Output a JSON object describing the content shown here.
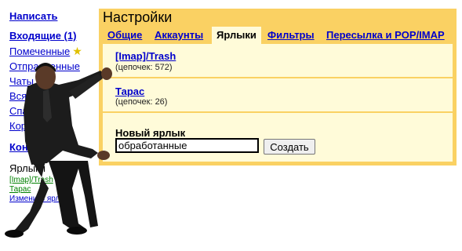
{
  "nav": {
    "compose": "Написать",
    "inbox": "Входящие (1)",
    "starred": "Помеченные",
    "sent": "Отправленные",
    "chats": "Чаты",
    "all_mail": "Вся почта",
    "spam": "Спам",
    "trash": "Корзина",
    "contacts": "Контакты",
    "labels_heading": "Ярлыки",
    "label_imap_trash": "[Imap]/Trash",
    "label_taras": "Тарас",
    "edit_labels": "Изменить ярлыки"
  },
  "settings": {
    "title": "Настройки",
    "tabs": [
      {
        "label": "Общие",
        "active": false
      },
      {
        "label": "Аккаунты",
        "active": false
      },
      {
        "label": "Ярлыки",
        "active": true
      },
      {
        "label": "Фильтры",
        "active": false
      },
      {
        "label": "Пересылка и POP/IMAP",
        "active": false
      }
    ],
    "labels": [
      {
        "name": "[Imap]/Trash",
        "count": "(цепочек: 572)"
      },
      {
        "name": "Тарас",
        "count": "(цепочек: 26)"
      }
    ],
    "new_label_heading": "Новый ярлык",
    "new_label_value": "обработанные",
    "create_button": "Создать"
  },
  "colors": {
    "panel": "#fad163",
    "content": "#fffbd9",
    "link": "#0000cc"
  }
}
